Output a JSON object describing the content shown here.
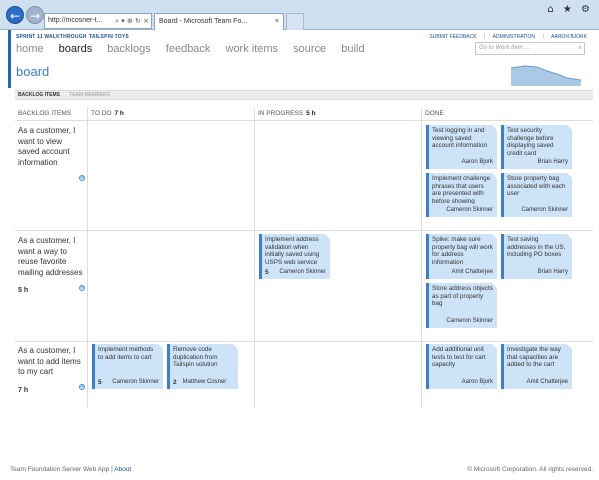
{
  "browser": {
    "address": "http://mcosner-t...",
    "address_controls": "⌕ ▾ ⊕ ↻ ×",
    "tabs": [
      {
        "label": "Board - Microsoft Team Fo...",
        "close": "×"
      }
    ],
    "window_controls": "⌂ ★ ⚙"
  },
  "header": {
    "project": "SPRINT 11 WALKTHROUGH",
    "team": "TAILSPIN TOYS",
    "links": [
      "SUBMIT FEEDBACK",
      "ADMINISTRATION",
      "AARON BJORK"
    ],
    "separator": "|",
    "menu": [
      "home",
      "boards",
      "backlogs",
      "feedback",
      "work items",
      "source",
      "build"
    ],
    "active_menu": "boards",
    "search_placeholder": "Go to Work Item ...",
    "search_icon": "search-icon"
  },
  "page_title": "board",
  "subnav": [
    "BACKLOG ITEMS",
    "TEAM MEMBERS"
  ],
  "columns": {
    "backlog": {
      "label": "BACKLOG ITEMS",
      "hours": ""
    },
    "todo": {
      "label": "TO DO",
      "hours": "7 h"
    },
    "inprogress": {
      "label": "IN PROGRESS",
      "hours": "5 h"
    },
    "done": {
      "label": "DONE",
      "hours": ""
    }
  },
  "stories": [
    {
      "title": "As a customer, I want to view saved account information",
      "hours": ""
    },
    {
      "title": "As a customer, I want a way to reuse favorite mailing addresses",
      "hours": "5 h"
    },
    {
      "title": "As a customer, I want to add items to my cart",
      "hours": "7 h"
    }
  ],
  "add_icon": "⊕",
  "cards": {
    "r1_done_1": {
      "title": "Test logging in and viewing saved account information",
      "remaining": "",
      "owner": "Aaron Bjork"
    },
    "r1_done_2": {
      "title": "Test security challenge before displaying saved credit card",
      "remaining": "",
      "owner": "Brian Harry"
    },
    "r1_done_3": {
      "title": "Implement challenge phrases that users are presented with before showing",
      "remaining": "",
      "owner": "Cameron Skinner"
    },
    "r1_done_4": {
      "title": "Store property bag associated with each user",
      "remaining": "",
      "owner": "Cameron Skinner"
    },
    "r2_prog_1": {
      "title": "Implement address validation when initially saved using USPS web service",
      "remaining": "5",
      "owner": "Cameron Skinner"
    },
    "r2_done_1": {
      "title": "Spike: make sure property bag will work for address information",
      "remaining": "",
      "owner": "Amit Chatterjee"
    },
    "r2_done_2": {
      "title": "Test saving addresses in the US, including PO boxes",
      "remaining": "",
      "owner": "Brian Harry"
    },
    "r2_done_3": {
      "title": "Store address objects as part of property bag",
      "remaining": "",
      "owner": "Cameron Skinner"
    },
    "r3_todo_1": {
      "title": "Implement methods to add items to cart",
      "remaining": "5",
      "owner": "Cameron Skinner"
    },
    "r3_todo_2": {
      "title": "Remove code duplication from Tailspin solution",
      "remaining": "2",
      "owner": "Matthew Cosner"
    },
    "r3_done_1": {
      "title": "Add additional unit tests to test for cart capacity",
      "remaining": "",
      "owner": "Aaron Bjork"
    },
    "r3_done_2": {
      "title": "Investigate the way that capacities are added to the cart",
      "remaining": "",
      "owner": "Amit Chatterjee"
    }
  },
  "footer": {
    "app": "Team Foundation Server Web App",
    "separator": "|",
    "about": "About",
    "copyright": "© Microsoft Corporation. All rights reserved."
  },
  "colors": {
    "accent": "#1f67c0",
    "card": "#cde3f7",
    "card_border": "#3a7fd1"
  }
}
